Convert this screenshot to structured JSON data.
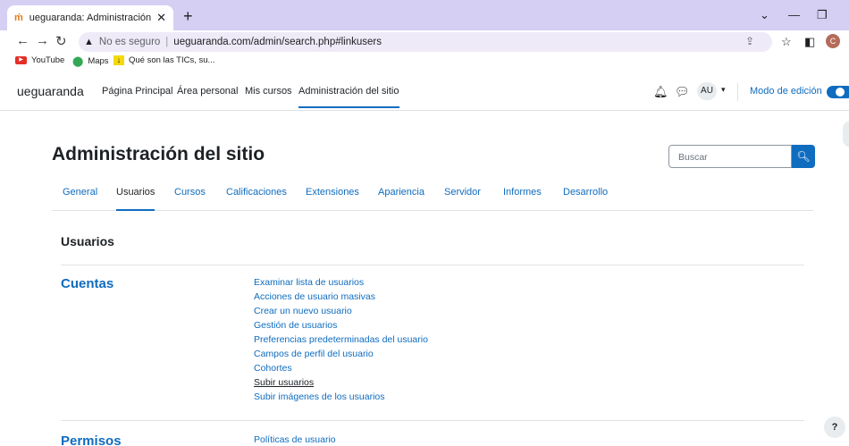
{
  "browser": {
    "tab_title": "ueguaranda: Administración: Bus",
    "favicon": "ḿ",
    "new_tab_label": "+",
    "omnibox_insecure": "No es seguro",
    "omnibox_url": "ueguaranda.com/admin/search.php#linkusers",
    "profile_initial": "C",
    "bookmarks": [
      "YouTube",
      "Maps",
      "Qué son las TICs, su..."
    ]
  },
  "navbar": {
    "brand": "ueguaranda",
    "links": [
      "Página Principal",
      "Área personal",
      "Mis cursos",
      "Administración del sitio"
    ],
    "user_initials": "AU",
    "edit_mode_label": "Modo de edición"
  },
  "page": {
    "title": "Administración del sitio",
    "search_placeholder": "Buscar",
    "tabs": [
      "General",
      "Usuarios",
      "Cursos",
      "Calificaciones",
      "Extensiones",
      "Apariencia",
      "Servidor",
      "Informes",
      "Desarrollo"
    ],
    "section_title": "Usuarios",
    "categories": [
      {
        "name": "Cuentas",
        "links": [
          "Examinar lista de usuarios",
          "Acciones de usuario masivas",
          "Crear un nuevo usuario",
          "Gestión de usuarios",
          "Preferencias predeterminadas del usuario",
          "Campos de perfil del usuario",
          "Cohortes",
          "Subir usuarios",
          "Subir imágenes de los usuarios"
        ]
      },
      {
        "name": "Permisos",
        "links": [
          "Políticas de usuario"
        ]
      }
    ],
    "help_label": "?"
  },
  "colors": {
    "accent": "#0f6cbf",
    "tabstrip": "#d5cff3",
    "text": "#1d2125"
  }
}
